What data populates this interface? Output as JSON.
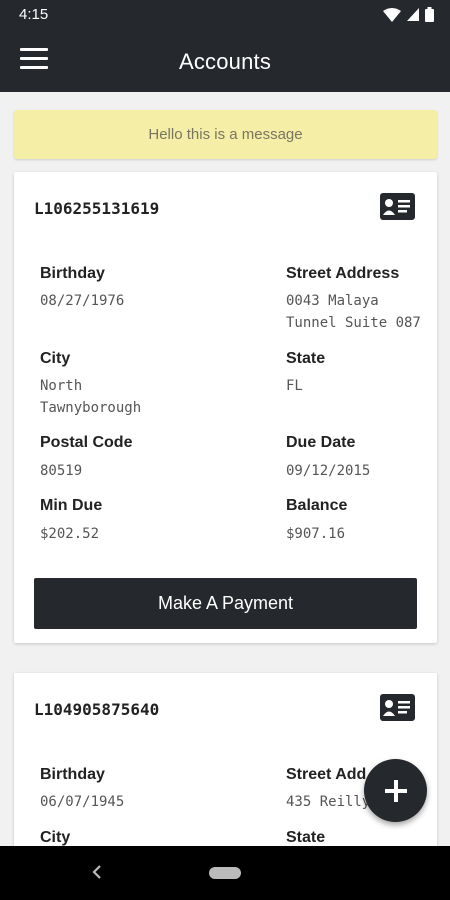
{
  "status_bar": {
    "time": "4:15"
  },
  "app_bar": {
    "title": "Accounts"
  },
  "message": "Hello this is a message",
  "accounts": [
    {
      "account_number": "L106255131619",
      "birthday_label": "Birthday",
      "birthday": "08/27/1976",
      "street_label": "Street Address",
      "street": "0043 Malaya\nTunnel Suite 087",
      "city_label": "City",
      "city": "North\nTawnyborough",
      "state_label": "State",
      "state": "FL",
      "postal_label": "Postal Code",
      "postal": "80519",
      "due_date_label": "Due Date",
      "due_date": "09/12/2015",
      "min_due_label": "Min Due",
      "min_due": "$202.52",
      "balance_label": "Balance",
      "balance": "$907.16",
      "pay_button": "Make A Payment"
    },
    {
      "account_number": "L104905875640",
      "birthday_label": "Birthday",
      "birthday": "06/07/1945",
      "street_label": "Street Add",
      "street": "435 Reilly R",
      "city_label": "City",
      "state_label": "State"
    }
  ],
  "icons": {
    "menu": "menu-icon",
    "id_card": "id-card-icon",
    "add": "plus-icon",
    "back": "back-icon",
    "home": "home-pill",
    "wifi": "wifi-icon",
    "signal": "signal-icon",
    "battery": "battery-icon"
  },
  "colors": {
    "primary_dark": "#25282d",
    "banner": "#f4eea6",
    "background": "#f1f1f1"
  }
}
